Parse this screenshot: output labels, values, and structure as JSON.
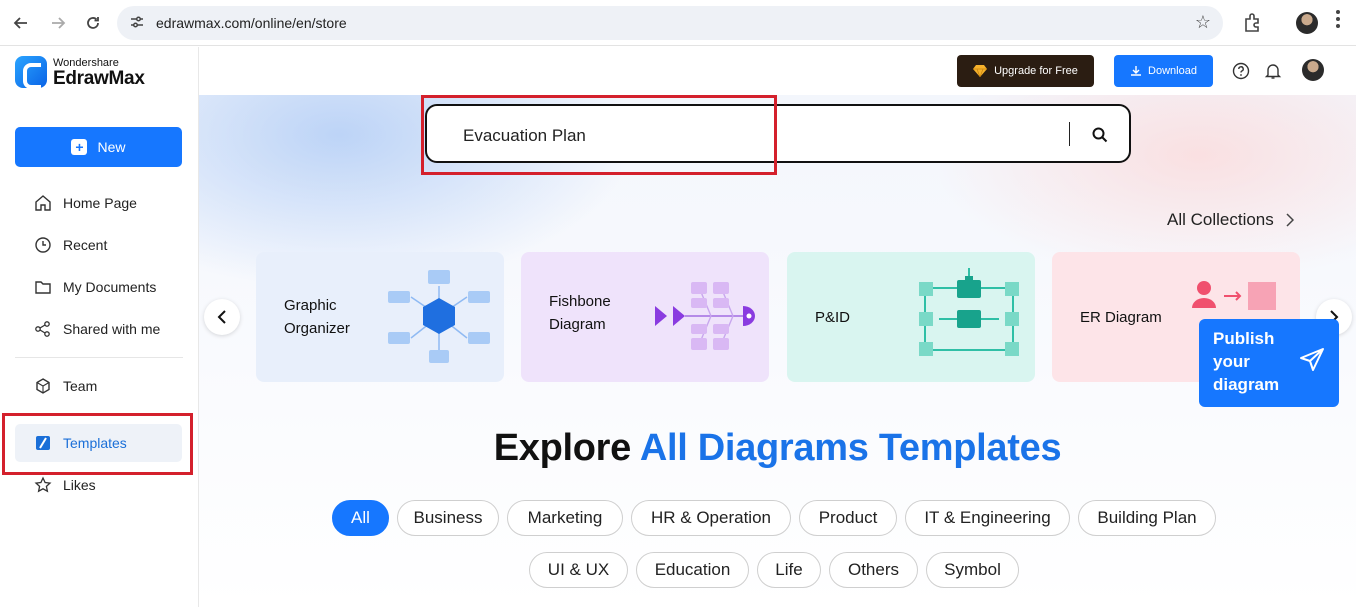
{
  "browser": {
    "url": "edrawmax.com/online/en/store"
  },
  "sidebar": {
    "brand_small": "Wondershare",
    "brand_big": "EdrawMax",
    "new_label": "New",
    "items": [
      {
        "label": "Home Page",
        "icon": "home-icon"
      },
      {
        "label": "Recent",
        "icon": "clock-icon"
      },
      {
        "label": "My Documents",
        "icon": "folder-icon"
      },
      {
        "label": "Shared with me",
        "icon": "share-icon"
      },
      {
        "label": "Team",
        "icon": "team-cube-icon"
      },
      {
        "label": "Templates",
        "icon": "templates-icon"
      },
      {
        "label": "Likes",
        "icon": "star-icon"
      }
    ],
    "active_item": "Templates"
  },
  "topbar": {
    "upgrade_label": "Upgrade for Free",
    "download_label": "Download"
  },
  "search": {
    "value": "Evacuation Plan"
  },
  "collections": {
    "all_label": "All Collections",
    "cards": [
      {
        "title_line1": "Graphic",
        "title_line2": "Organizer",
        "color": "#e8effb"
      },
      {
        "title_line1": "Fishbone",
        "title_line2": "Diagram",
        "color": "#efe3fb"
      },
      {
        "title_line1": "P&ID",
        "title_line2": "",
        "color": "#d9f5f0"
      },
      {
        "title_line1": "ER Diagram",
        "title_line2": "",
        "color": "#fde4e8"
      }
    ]
  },
  "publish": {
    "line1": "Publish",
    "line2": "your",
    "line3": "diagram"
  },
  "explore": {
    "prefix": "Explore",
    "highlight": "All Diagrams Templates"
  },
  "filters": {
    "row1": [
      "All",
      "Business",
      "Marketing",
      "HR & Operation",
      "Product",
      "IT & Engineering",
      "Building Plan"
    ],
    "row2": [
      "UI & UX",
      "Education",
      "Life",
      "Others",
      "Symbol"
    ],
    "active": "All"
  },
  "colors": {
    "accent": "#1677ff",
    "highlight_box": "#d4202c",
    "upgrade_bg": "#2b1d12"
  }
}
